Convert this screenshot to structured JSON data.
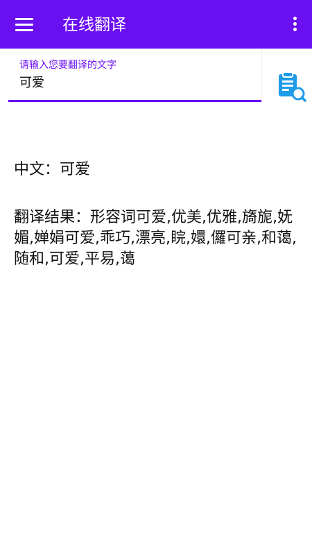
{
  "toolbar": {
    "title": "在线翻译",
    "menu_icon": "hamburger-menu-icon",
    "more_icon": "vertical-dots-icon",
    "color": "#6a0ff0"
  },
  "input": {
    "label": "请输入您要翻译的文字",
    "value": "可爱",
    "accent_color": "#6a0ff0"
  },
  "translate_button": {
    "icon": "clipboard-search-icon",
    "color": "#1e9be9"
  },
  "result": {
    "source_label": "中文：",
    "source_text": "可爱",
    "result_label": "翻译结果：",
    "result_text": "形容词可爱,优美,优雅,旖旎,妩媚,婵娟可爱,乖巧,漂亮,睆,嬛,儸可亲,和蔼,随和,可爱,平易,蔼"
  }
}
